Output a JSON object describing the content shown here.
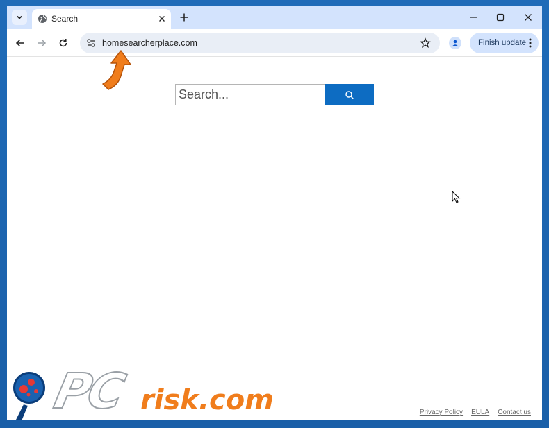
{
  "tab": {
    "title": "Search"
  },
  "omnibox": {
    "url": "homesearcherplace.com"
  },
  "toolbar": {
    "finish_update_label": "Finish update"
  },
  "page": {
    "search_placeholder": "Search...",
    "footer_links": [
      "Privacy Policy",
      "EULA",
      "Contact us"
    ]
  },
  "watermark": {
    "brand": "PCrisk.com",
    "part1": "PC",
    "part2": "risk.com"
  },
  "colors": {
    "accent": "#0d6cc2",
    "tabstrip": "#d3e3fd",
    "arrow": "#f07d1c"
  }
}
